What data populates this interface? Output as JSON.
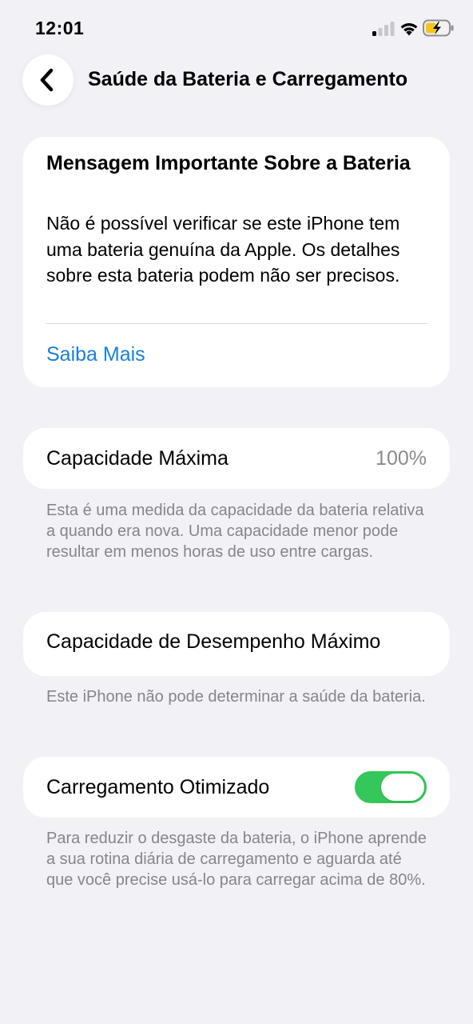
{
  "status_bar": {
    "time": "12:01",
    "icons": [
      "cellular-signal-icon",
      "wifi-icon",
      "battery-charging-icon"
    ],
    "battery_color": "#f5c518"
  },
  "nav": {
    "back_icon": "chevron-left-icon",
    "title": "Saúde da Bateria e Carregamento"
  },
  "important_message": {
    "title": "Mensagem Importante Sobre a Bateria",
    "body": "Não é possível verificar se este iPhone tem uma bateria genuína da Apple. Os detalhes sobre esta bateria podem não ser precisos.",
    "link_label": "Saiba Mais",
    "link_color": "#1a7fd8"
  },
  "max_capacity": {
    "label": "Capacidade Máxima",
    "value": "100%",
    "footnote": "Esta é uma medida da capacidade da bateria relativa a quando era nova. Uma capacidade menor pode resultar em menos horas de uso entre cargas."
  },
  "peak_performance": {
    "label": "Capacidade de Desempenho Máximo",
    "footnote": "Este iPhone não pode determinar a saúde da bateria."
  },
  "optimized_charging": {
    "label": "Carregamento Otimizado",
    "enabled": true,
    "toggle_color": "#34c759",
    "footnote": "Para reduzir o desgaste da bateria, o iPhone aprende a sua rotina diária de carregamento e aguarda até que você precise usá-lo para carregar acima de 80%."
  }
}
